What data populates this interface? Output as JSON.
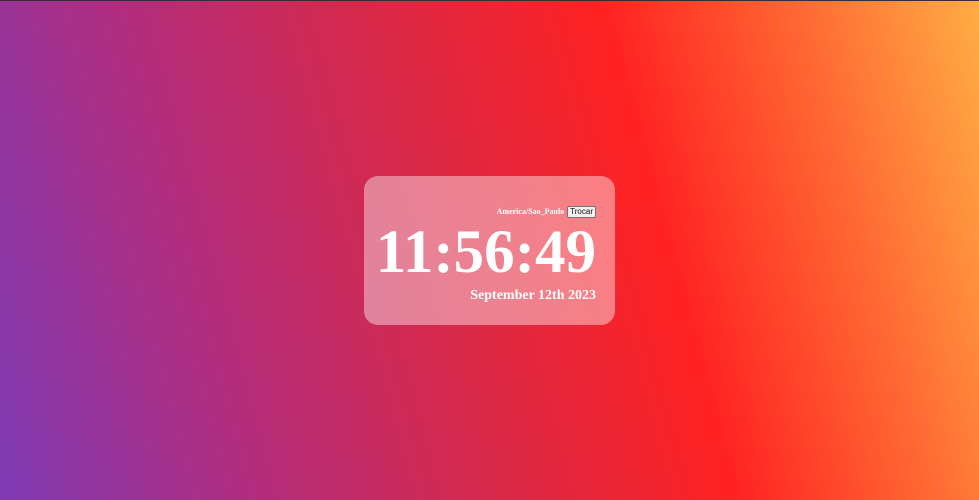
{
  "clock": {
    "timezone": "America/Sao_Paulo",
    "swap_label": "Trocar",
    "time": "11:56:49",
    "date": "September 12th 2023"
  },
  "colors": {
    "gradient_left": "#7f3bb5",
    "gradient_mid": "#ff2222",
    "gradient_right": "#ffad44",
    "card_background": "rgba(255,255,255,0.42)",
    "text": "#ffffff"
  }
}
